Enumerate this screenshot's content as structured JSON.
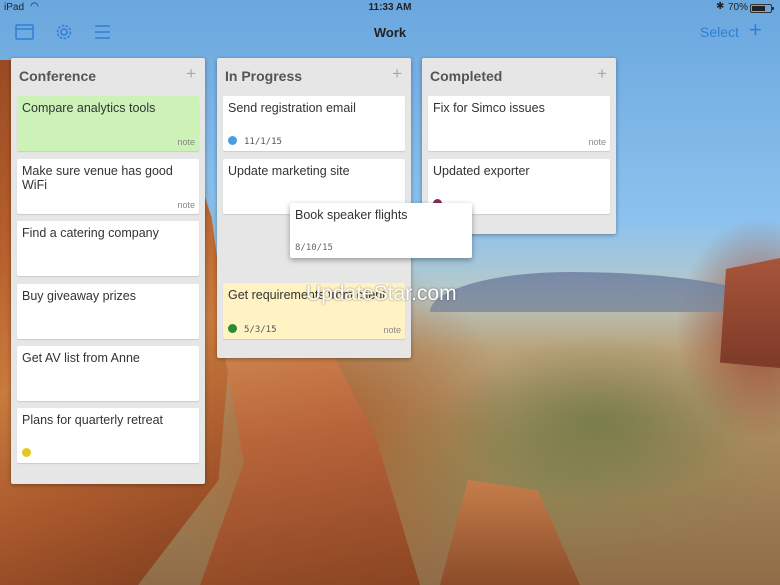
{
  "status_bar": {
    "device": "iPad",
    "wifi_icon": "◠",
    "time": "11:33 AM",
    "bluetooth_icon": "✱",
    "battery": "70%"
  },
  "nav": {
    "title": "Work",
    "select_label": "Select",
    "add_label": "+",
    "icons": [
      "boards-icon",
      "settings-gear-icon",
      "menu-list-icon"
    ],
    "accent": "#2f7fd1"
  },
  "columns": [
    {
      "title": "Conference",
      "add": "+",
      "cards": [
        {
          "text": "Compare analytics tools",
          "note": "note",
          "color": "#ccf2b8"
        },
        {
          "text": "Make sure venue has good WiFi",
          "note": "note"
        },
        {
          "text": "Find a catering company"
        },
        {
          "text": "Buy giveaway prizes"
        },
        {
          "text": "Get AV list from Anne"
        },
        {
          "text": "Plans for quarterly retreat",
          "dot_color": "#e8c51f"
        }
      ]
    },
    {
      "title": "In Progress",
      "add": "+",
      "cards": [
        {
          "text": "Send registration email",
          "date": "11/1/15",
          "dot_color": "#4a9de0"
        },
        {
          "text": "Update marketing site"
        },
        {
          "text": "Get requirements from client",
          "date": "5/3/15",
          "dot_color": "#2e8a2e",
          "note": "note",
          "color": "#fff3c4"
        }
      ]
    },
    {
      "title": "Completed",
      "add": "+",
      "cards": [
        {
          "text": "Fix for Simco issues",
          "note": "note"
        },
        {
          "text": "Updated exporter",
          "dot_color": "#8a2a5a"
        }
      ]
    }
  ],
  "dragging_card": {
    "text": "Book speaker flights",
    "date": "8/10/15"
  },
  "watermark": "UpdateStar.com"
}
